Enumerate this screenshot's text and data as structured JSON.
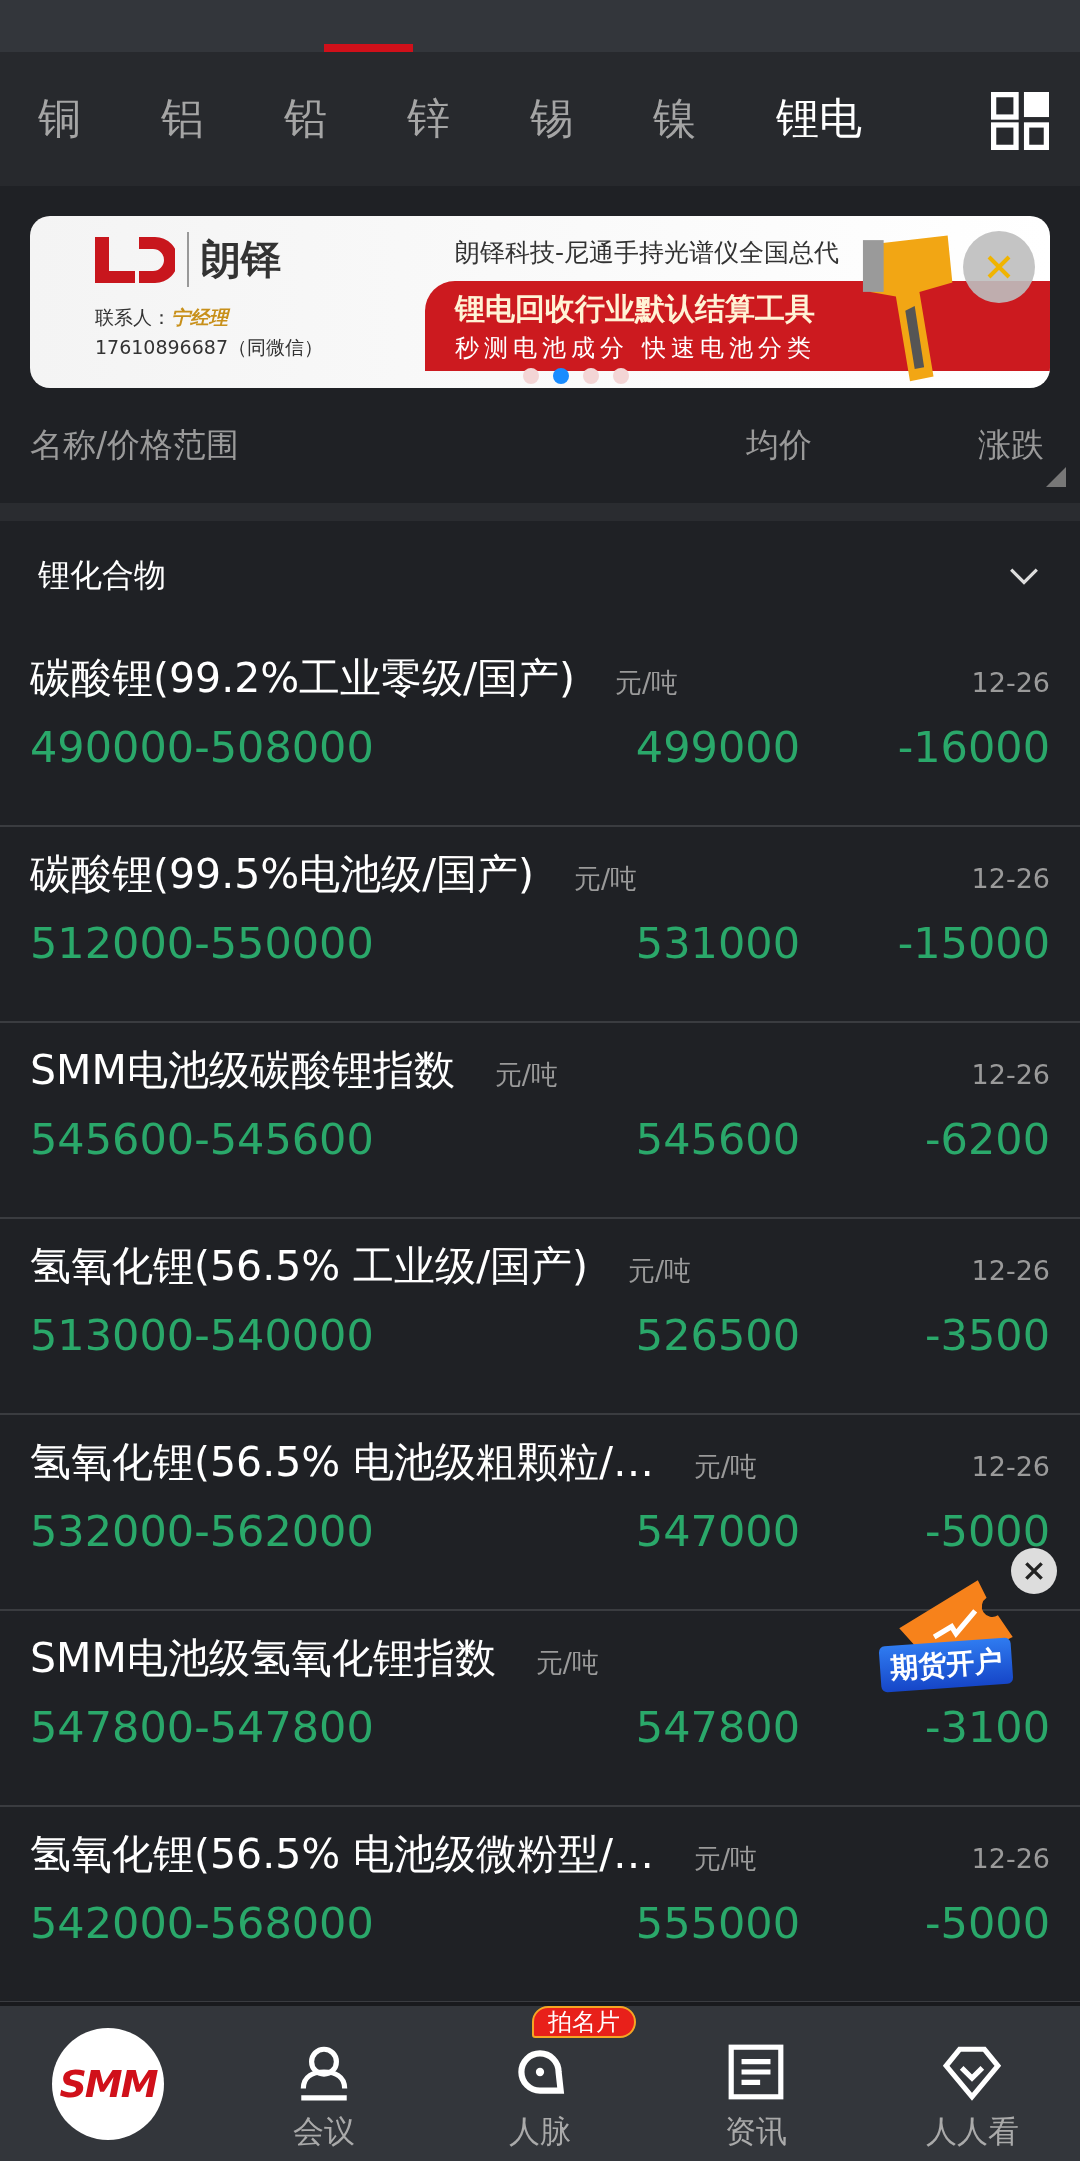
{
  "tabs": [
    {
      "label": "铜",
      "selected": false
    },
    {
      "label": "铝",
      "selected": false
    },
    {
      "label": "铅",
      "selected": false
    },
    {
      "label": "锌",
      "selected": false
    },
    {
      "label": "锡",
      "selected": false
    },
    {
      "label": "镍",
      "selected": false
    },
    {
      "label": "锂电",
      "selected": true
    }
  ],
  "banner": {
    "brand": "朗铎",
    "tagline": "朗铎科技-尼通手持光谱仪全国总代",
    "contact_label": "联系人：",
    "contact_name": "宁经理",
    "phone": "17610896687（同微信）",
    "headline": "锂电回收行业默认结算工具",
    "subline": "秒测电池成分   快速电池分类",
    "dots": [
      {
        "selected": false
      },
      {
        "selected": true
      },
      {
        "selected": false
      },
      {
        "selected": false
      }
    ]
  },
  "columns": [
    "名称/价格范围",
    "均价",
    "涨跌"
  ],
  "section": {
    "title": "锂化合物",
    "expanded": true
  },
  "rows": [
    {
      "name": "碳酸锂(99.2%工业零级/国产)",
      "unit": "元/吨",
      "date": "12-26",
      "range": "490000-508000",
      "avg": "499000",
      "change": "-16000"
    },
    {
      "name": "碳酸锂(99.5%电池级/国产)",
      "unit": "元/吨",
      "date": "12-26",
      "range": "512000-550000",
      "avg": "531000",
      "change": "-15000"
    },
    {
      "name": "SMM电池级碳酸锂指数",
      "unit": "元/吨",
      "date": "12-26",
      "range": "545600-545600",
      "avg": "545600",
      "change": "-6200"
    },
    {
      "name": "氢氧化锂(56.5% 工业级/国产)",
      "unit": "元/吨",
      "date": "12-26",
      "range": "513000-540000",
      "avg": "526500",
      "change": "-3500"
    },
    {
      "name": "氢氧化锂(56.5% 电池级粗颗粒/…",
      "unit": "元/吨",
      "date": "12-26",
      "range": "532000-562000",
      "avg": "547000",
      "change": "-5000"
    },
    {
      "name": "SMM电池级氢氧化锂指数",
      "unit": "元/吨",
      "range": "547800-547800",
      "avg": "547800",
      "change": "-3100"
    },
    {
      "name": "氢氧化锂(56.5% 电池级微粉型/…",
      "unit": "元/吨",
      "date": "12-26",
      "range": "542000-568000",
      "avg": "555000",
      "change": "-5000"
    }
  ],
  "float_ad": {
    "label": "期货开户"
  },
  "nav": [
    {
      "kind": "logo",
      "label": "SMM"
    },
    {
      "kind": "meeting",
      "label": "会议"
    },
    {
      "kind": "contacts",
      "label": "人脉",
      "badge": "拍名片"
    },
    {
      "kind": "news",
      "label": "资讯"
    },
    {
      "kind": "watch",
      "label": "人人看"
    }
  ]
}
